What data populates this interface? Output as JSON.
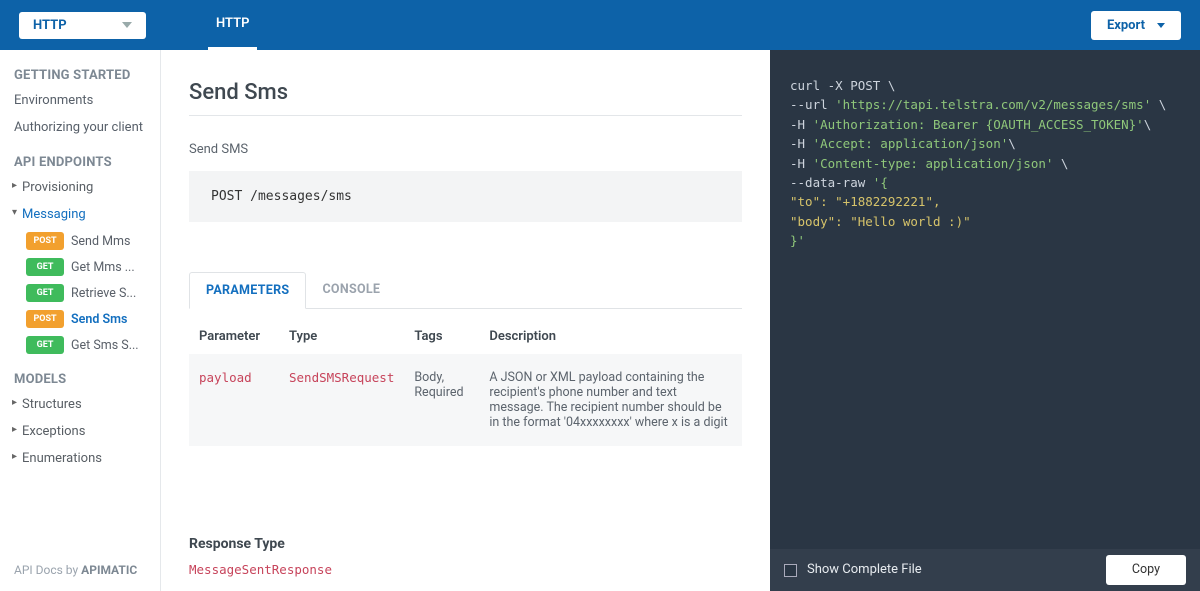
{
  "top": {
    "select": "HTTP",
    "tab": "HTTP",
    "export": "Export"
  },
  "sidebar": {
    "getting_started": "GETTING STARTED",
    "environments": "Environments",
    "authorizing": "Authorizing your client",
    "api_endpoints": "API ENDPOINTS",
    "provisioning": "Provisioning",
    "messaging": "Messaging",
    "methods": [
      {
        "verb": "POST",
        "label": "Send Mms"
      },
      {
        "verb": "GET",
        "label": "Get Mms ..."
      },
      {
        "verb": "GET",
        "label": "Retrieve S..."
      },
      {
        "verb": "POST",
        "label": "Send Sms"
      },
      {
        "verb": "GET",
        "label": "Get Sms S..."
      }
    ],
    "models": "MODELS",
    "structures": "Structures",
    "exceptions": "Exceptions",
    "enumerations": "Enumerations",
    "footer_pre": "API Docs by ",
    "footer_brand": "APIMATIC"
  },
  "main": {
    "title": "Send Sms",
    "subtitle": "Send SMS",
    "http_line": "POST /messages/sms",
    "tabs": {
      "parameters": "PARAMETERS",
      "console": "CONSOLE"
    },
    "table": {
      "h_param": "Parameter",
      "h_type": "Type",
      "h_tags": "Tags",
      "h_desc": "Description",
      "r_param": "payload",
      "r_type": "SendSMSRequest",
      "r_tags": "Body, Required",
      "r_desc": "A JSON or XML payload containing the recipient's phone number and text message. The recipient number should be in the format '04xxxxxxxx' where x is a digit"
    },
    "resp_h": "Response Type",
    "resp_t": "MessageSentResponse"
  },
  "code": {
    "l1a": "curl -X POST \\",
    "l2a": "  --url ",
    "l2b": "'https://tapi.telstra.com/v2/messages/sms'",
    "l2c": " \\",
    "l3a": "  -H ",
    "l3b": "'Authorization: Bearer {OAUTH_ACCESS_TOKEN}'",
    "l3c": "\\",
    "l4a": "  -H ",
    "l4b": "'Accept: application/json'",
    "l4c": "\\",
    "l5a": "  -H ",
    "l5b": "'Content-type: application/json'",
    "l5c": " \\",
    "l6a": "  --data-raw ",
    "l6b": "'{",
    "l7": "  \"to\": \"+1882292221\",",
    "l8": "  \"body\": \"Hello world :)\"",
    "l9": "}'",
    "show_complete": "Show Complete File",
    "copy": "Copy"
  }
}
